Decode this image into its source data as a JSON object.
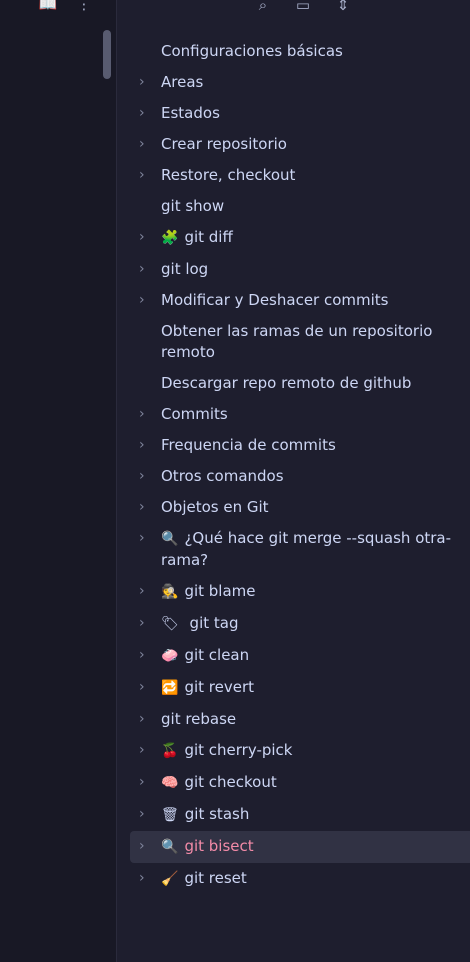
{
  "ribbon": {
    "book_icon": "📖",
    "more_icon": "⋮"
  },
  "toolbar": {
    "search_icon": "⌕",
    "layout_icon": "▭",
    "collapse_icon": "⇕"
  },
  "tree": {
    "items": [
      {
        "label": "Configuraciones básicas",
        "chevron": "",
        "emoji": ""
      },
      {
        "label": "Areas",
        "chevron": "›",
        "emoji": ""
      },
      {
        "label": "Estados",
        "chevron": "›",
        "emoji": ""
      },
      {
        "label": "Crear repositorio",
        "chevron": "›",
        "emoji": ""
      },
      {
        "label": "Restore, checkout",
        "chevron": "›",
        "emoji": ""
      },
      {
        "label": "git show",
        "chevron": "",
        "emoji": ""
      },
      {
        "label": "git diff",
        "chevron": "›",
        "emoji": "🧩"
      },
      {
        "label": "git log",
        "chevron": "›",
        "emoji": ""
      },
      {
        "label": "Modificar y Deshacer commits",
        "chevron": "›",
        "emoji": ""
      },
      {
        "label": "Obtener las ramas de un repositorio remoto",
        "chevron": "",
        "emoji": ""
      },
      {
        "label": "Descargar repo remoto de github",
        "chevron": "",
        "emoji": ""
      },
      {
        "label": "Commits",
        "chevron": "›",
        "emoji": ""
      },
      {
        "label": "Frequencia de commits",
        "chevron": "›",
        "emoji": ""
      },
      {
        "label": "Otros comandos",
        "chevron": "›",
        "emoji": ""
      },
      {
        "label": "Objetos en Git",
        "chevron": "›",
        "emoji": ""
      },
      {
        "label": "¿Qué hace git merge --squash otra-rama?",
        "chevron": "›",
        "emoji": "🔍"
      },
      {
        "label": "git blame",
        "chevron": "›",
        "emoji": "🕵"
      },
      {
        "label": " git tag",
        "chevron": "›",
        "emoji": "🏷"
      },
      {
        "label": "git clean",
        "chevron": "›",
        "emoji": "🧼"
      },
      {
        "label": "git revert",
        "chevron": "›",
        "emoji": "🔁"
      },
      {
        "label": "git rebase",
        "chevron": "›",
        "emoji": ""
      },
      {
        "label": "git cherry-pick",
        "chevron": "›",
        "emoji": "🍒"
      },
      {
        "label": "git checkout",
        "chevron": "›",
        "emoji": "🧠"
      },
      {
        "label": "git stash",
        "chevron": "›",
        "emoji": "🗑"
      },
      {
        "label": "git bisect",
        "chevron": "›",
        "emoji": "🔍"
      },
      {
        "label": "git reset",
        "chevron": "›",
        "emoji": "🧹"
      }
    ]
  },
  "colors": {
    "background": "#1e1e2e",
    "ribbon": "#181825",
    "active_bg": "#313244",
    "active_text": "#f38ba8",
    "text": "#cdd6f4"
  }
}
